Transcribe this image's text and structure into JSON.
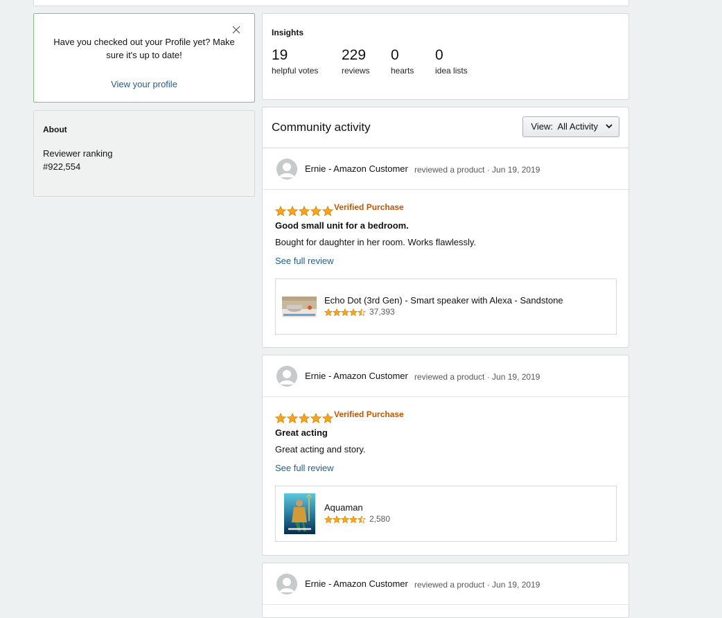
{
  "prompt": {
    "message": "Have you checked out your Profile yet? Make sure it's up to date!",
    "link": "View your profile"
  },
  "about": {
    "heading": "About",
    "ranking_label": "Reviewer ranking",
    "ranking_value": "#922,554"
  },
  "insights": {
    "heading": "Insights",
    "stats": [
      {
        "value": "19",
        "label": "helpful votes"
      },
      {
        "value": "229",
        "label": "reviews"
      },
      {
        "value": "0",
        "label": "hearts"
      },
      {
        "value": "0",
        "label": "idea lists"
      }
    ]
  },
  "community": {
    "title": "Community activity",
    "view_button": "View:  All Activity"
  },
  "activities": [
    {
      "author": "Ernie - Amazon Customer",
      "meta": "reviewed a product · Jun 19, 2019",
      "rating": 5,
      "verified": "Verified Purchase",
      "title": "Good small unit for a bedroom.",
      "body": "Bought for daughter in her room. Works flawlessly.",
      "link": "See full review",
      "product": {
        "name": "Echo Dot (3rd Gen) - Smart speaker with Alexa - Sandstone",
        "rating": 4.5,
        "count": "37,393",
        "thumb": "echo-dot-thumbnail"
      }
    },
    {
      "author": "Ernie - Amazon Customer",
      "meta": "reviewed a product · Jun 19, 2019",
      "rating": 5,
      "verified": "Verified Purchase",
      "title": "Great acting",
      "body": "Great acting and story.",
      "link": "See full review",
      "product": {
        "name": "Aquaman",
        "rating": 4.5,
        "count": "2,580",
        "thumb": "aquaman-poster-thumbnail"
      }
    },
    {
      "author": "Ernie - Amazon Customer",
      "meta": "reviewed a product · Jun 19, 2019"
    }
  ],
  "colors": {
    "star": "#ffa41c",
    "link": "#1e5f8e",
    "verified": "#c45500",
    "prompt_border": "#7fc47b"
  }
}
